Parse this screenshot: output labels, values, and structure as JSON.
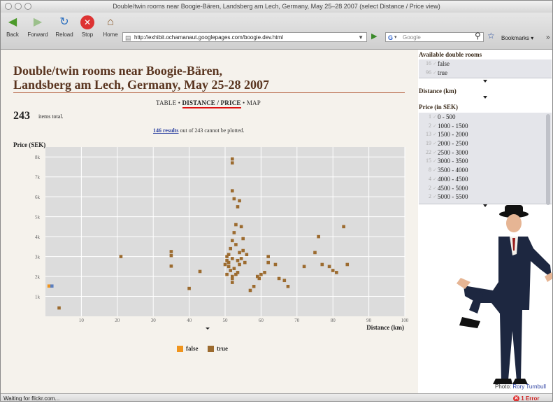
{
  "window": {
    "title": "Double/twin rooms near Boogie-Bären, Landsberg am Lech, Germany, May 25–28 2007 (select Distance / Price view)"
  },
  "toolbar": {
    "back_label": "Back",
    "forward_label": "Forward",
    "reload_label": "Reload",
    "stop_label": "Stop",
    "home_label": "Home",
    "url": "http://exhibit.ochamanaut.googlepages.com/boogie.dev.html",
    "search_placeholder": "Google",
    "bookmarks_label": "Bookmarks"
  },
  "page": {
    "title_line1": "Double/twin rooms near Boogie-Bären,",
    "title_line2": "Landsberg am Lech, Germany, May 25-28 2007",
    "views": {
      "table": "TABLE",
      "distance_price": "DISTANCE / PRICE",
      "map": "MAP",
      "sep": "•"
    },
    "items_count": "243",
    "items_label": "items total.",
    "plot_note_link": "146 results",
    "plot_note_rest": " out of 243 cannot be plotted.",
    "ylabel": "Price (SEK)",
    "xlabel": "Distance (km)",
    "legend": [
      {
        "label": "false",
        "color": "#f0951e"
      },
      {
        "label": "true",
        "color": "#9c6b2f"
      }
    ]
  },
  "chart_data": {
    "type": "scatter",
    "xlabel": "Distance (km)",
    "ylabel": "Price (SEK)",
    "xlim": [
      0,
      100
    ],
    "ylim": [
      0,
      8500
    ],
    "x_ticks": [
      10,
      20,
      30,
      40,
      50,
      60,
      70,
      80,
      90,
      100
    ],
    "y_ticks": [
      1000,
      2000,
      3000,
      4000,
      5000,
      6000,
      7000,
      8000
    ],
    "y_tick_labels": [
      "1k",
      "2k",
      "3k",
      "4k",
      "5k",
      "6k",
      "7k",
      "8k"
    ],
    "grid": true,
    "series": [
      {
        "name": "false",
        "color": "#f0951e",
        "points": [
          [
            1.0,
            1520
          ]
        ]
      },
      {
        "name": "false",
        "color": "#5b7fc0",
        "points": [
          [
            1.8,
            1520
          ]
        ]
      },
      {
        "name": "true",
        "color": "#9c6b2f",
        "points": [
          [
            3.8,
            420
          ],
          [
            21,
            3000
          ],
          [
            35,
            3250
          ],
          [
            35,
            3050
          ],
          [
            35,
            2520
          ],
          [
            40,
            1400
          ],
          [
            43,
            2250
          ],
          [
            50,
            2600
          ],
          [
            50.5,
            2800
          ],
          [
            51,
            3100
          ],
          [
            51.5,
            3400
          ],
          [
            52,
            3800
          ],
          [
            52,
            2900
          ],
          [
            52.5,
            2400
          ],
          [
            53,
            2100
          ],
          [
            53,
            3600
          ],
          [
            52.5,
            4200
          ],
          [
            53,
            4600
          ],
          [
            50.5,
            3000
          ],
          [
            51,
            2700
          ],
          [
            51.5,
            2300
          ],
          [
            52,
            2000
          ],
          [
            52,
            1900
          ],
          [
            53.5,
            2800
          ],
          [
            54,
            3200
          ],
          [
            54,
            2600
          ],
          [
            53.5,
            2200
          ],
          [
            54.5,
            2900
          ],
          [
            55,
            3300
          ],
          [
            55.5,
            2700
          ],
          [
            56,
            3100
          ],
          [
            55,
            3900
          ],
          [
            54.5,
            4500
          ],
          [
            53.5,
            5500
          ],
          [
            54,
            5800
          ],
          [
            52.5,
            5900
          ],
          [
            52,
            6300
          ],
          [
            52,
            7900
          ],
          [
            52,
            7700
          ],
          [
            51,
            2500
          ],
          [
            50.5,
            2100
          ],
          [
            52,
            1700
          ],
          [
            57,
            1300
          ],
          [
            58,
            1500
          ],
          [
            59,
            2000
          ],
          [
            59.5,
            1900
          ],
          [
            60,
            2100
          ],
          [
            61,
            2200
          ],
          [
            62,
            3000
          ],
          [
            62,
            2700
          ],
          [
            64,
            2600
          ],
          [
            65,
            1900
          ],
          [
            66.5,
            1800
          ],
          [
            67.5,
            1500
          ],
          [
            72,
            2500
          ],
          [
            75,
            3200
          ],
          [
            76,
            4000
          ],
          [
            77,
            2600
          ],
          [
            79,
            2500
          ],
          [
            80,
            2300
          ],
          [
            81,
            2200
          ],
          [
            83,
            4500
          ],
          [
            84,
            2600
          ]
        ]
      }
    ]
  },
  "sidebar": {
    "facet1": {
      "title": "Available double rooms",
      "items": [
        {
          "count": "16",
          "label": "false"
        },
        {
          "count": "96",
          "label": "true"
        }
      ]
    },
    "facet2": {
      "title": "Distance (km)"
    },
    "facet3": {
      "title": "Price (in SEK)",
      "items": [
        {
          "count": "1",
          "label": "0 - 500"
        },
        {
          "count": "2",
          "label": "1000 - 1500"
        },
        {
          "count": "13",
          "label": "1500 - 2000"
        },
        {
          "count": "19",
          "label": "2000 - 2500"
        },
        {
          "count": "22",
          "label": "2500 - 3000"
        },
        {
          "count": "15",
          "label": "3000 - 3500"
        },
        {
          "count": "8",
          "label": "3500 - 4000"
        },
        {
          "count": "4",
          "label": "4000 - 4500"
        },
        {
          "count": "2",
          "label": "4500 - 5000"
        },
        {
          "count": "2",
          "label": "5000 - 5500"
        }
      ]
    },
    "photo_credit_prefix": "Photo:",
    "photo_credit_name": "Rory Turnbull"
  },
  "status": {
    "text": "Waiting for flickr.com...",
    "error": "1 Error"
  }
}
